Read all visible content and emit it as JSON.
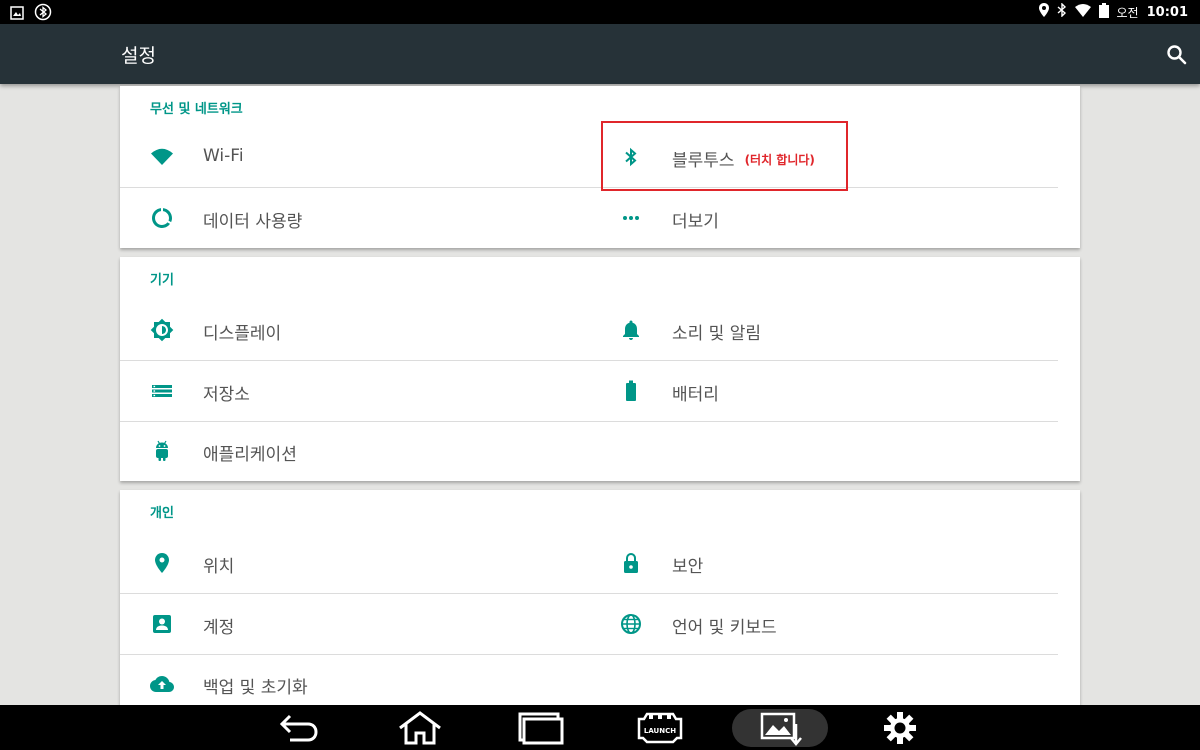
{
  "status_bar": {
    "ampm": "오전",
    "time": "10:01"
  },
  "toolbar": {
    "title": "설정"
  },
  "sections": {
    "wireless": {
      "title": "무선 및 네트워크",
      "wifi": "Wi-Fi",
      "bluetooth": "블루투스",
      "bluetooth_hint": "(터치 합니다)",
      "data_usage": "데이터 사용량",
      "more": "더보기"
    },
    "device": {
      "title": "기기",
      "display": "디스플레이",
      "sound": "소리 및 알림",
      "storage": "저장소",
      "battery": "배터리",
      "apps": "애플리케이션"
    },
    "personal": {
      "title": "개인",
      "location": "위치",
      "security": "보안",
      "accounts": "계정",
      "language": "언어 및 키보드",
      "backup": "백업 및 초기화"
    }
  },
  "navbar": {
    "launch_label": "LAUNCH"
  },
  "colors": {
    "accent": "#009688",
    "toolbar": "#263238",
    "highlight": "#e0262b"
  }
}
